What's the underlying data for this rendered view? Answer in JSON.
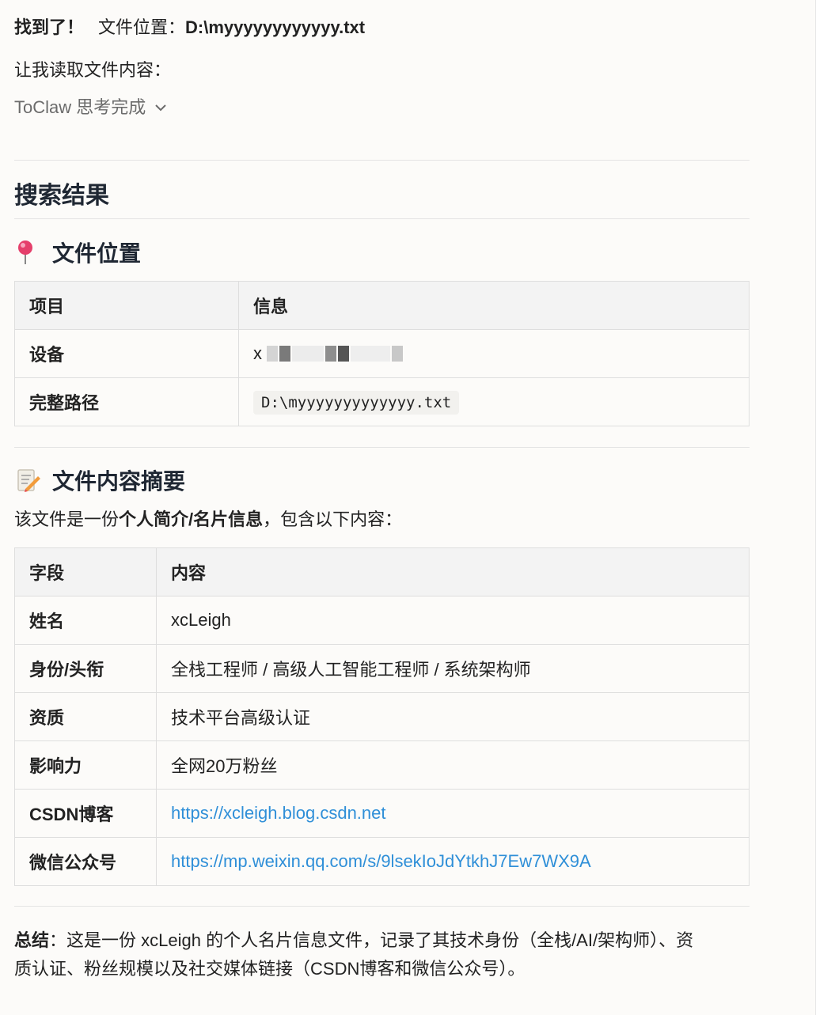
{
  "found": {
    "label": "找到了！",
    "prefix": "文件位置：",
    "path": "D:\\myyyyyyyyyyyy.txt"
  },
  "read_line": "让我读取文件内容：",
  "thinking": {
    "label": "ToClaw 思考完成",
    "chevron_icon": "chevron-down-icon"
  },
  "section_title": "搜索结果",
  "location": {
    "title": "文件位置",
    "icon": "pushpin-icon",
    "headers": [
      "项目",
      "信息"
    ],
    "rows": [
      {
        "key": "设备",
        "value": "x"
      },
      {
        "key": "完整路径",
        "value": "D:\\myyyyyyyyyyyyy.txt"
      }
    ]
  },
  "summary": {
    "title": "文件内容摘要",
    "icon": "memo-icon",
    "intro_pre": "该文件是一份",
    "intro_bold": "个人简介/名片信息",
    "intro_post": "，包含以下内容：",
    "headers": [
      "字段",
      "内容"
    ],
    "rows": [
      {
        "key": "姓名",
        "value": "xcLeigh"
      },
      {
        "key": "身份/头衔",
        "value": "全栈工程师 / 高级人工智能工程师 / 系统架构师"
      },
      {
        "key": "资质",
        "value": "技术平台高级认证"
      },
      {
        "key": "影响力",
        "value": "全网20万粉丝"
      },
      {
        "key": "CSDN博客",
        "value": "https://xcleigh.blog.csdn.net"
      },
      {
        "key": "微信公众号",
        "value": "https://mp.weixin.qq.com/s/9lsekIoJdYtkhJ7Ew7WX9A"
      }
    ]
  },
  "conclusion": {
    "label": "总结",
    "text": "：这是一份 xcLeigh 的个人名片信息文件，记录了其技术身份（全栈/AI/架构师）、资质认证、粉丝规模以及社交媒体链接（CSDN博客和微信公众号）。"
  },
  "colors": {
    "link": "#2f8fd8",
    "header_bg": "#f3f3f3",
    "page_bg": "#fcfbf9"
  }
}
